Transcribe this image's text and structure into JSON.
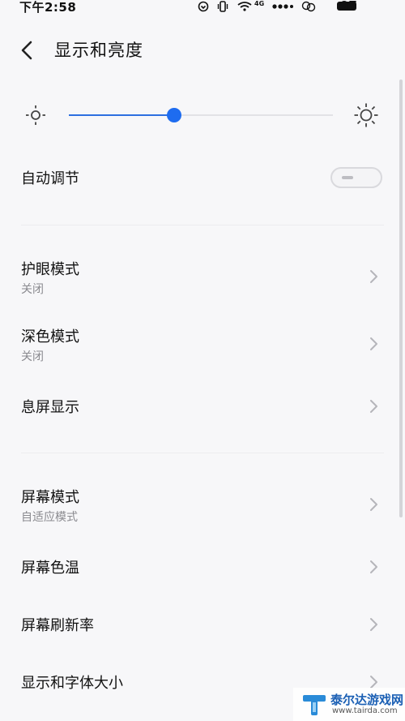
{
  "status_bar": {
    "time": "下午2:58",
    "battery_level": "97",
    "network_label": "4G",
    "icons": [
      "alarm-icon",
      "vibrate-icon",
      "wifi-icon",
      "signal-dots-icon",
      "hd-icon",
      "battery-icon"
    ]
  },
  "header": {
    "title": "显示和亮度",
    "back_icon": "chevron-left-icon"
  },
  "brightness": {
    "level_fraction": 0.4,
    "accent_color": "#1e6cf0"
  },
  "auto_adjust": {
    "label": "自动调节",
    "enabled": false
  },
  "group1": [
    {
      "label": "护眼模式",
      "sub": "关闭"
    },
    {
      "label": "深色模式",
      "sub": "关闭"
    },
    {
      "label": "息屏显示",
      "sub": ""
    }
  ],
  "group2": [
    {
      "label": "屏幕模式",
      "sub": "自适应模式"
    },
    {
      "label": "屏幕色温",
      "sub": ""
    },
    {
      "label": "屏幕刷新率",
      "sub": ""
    },
    {
      "label": "显示和字体大小",
      "sub": ""
    }
  ],
  "watermark": {
    "name": "泰尔达游戏网",
    "url": "www.tairda.com"
  }
}
